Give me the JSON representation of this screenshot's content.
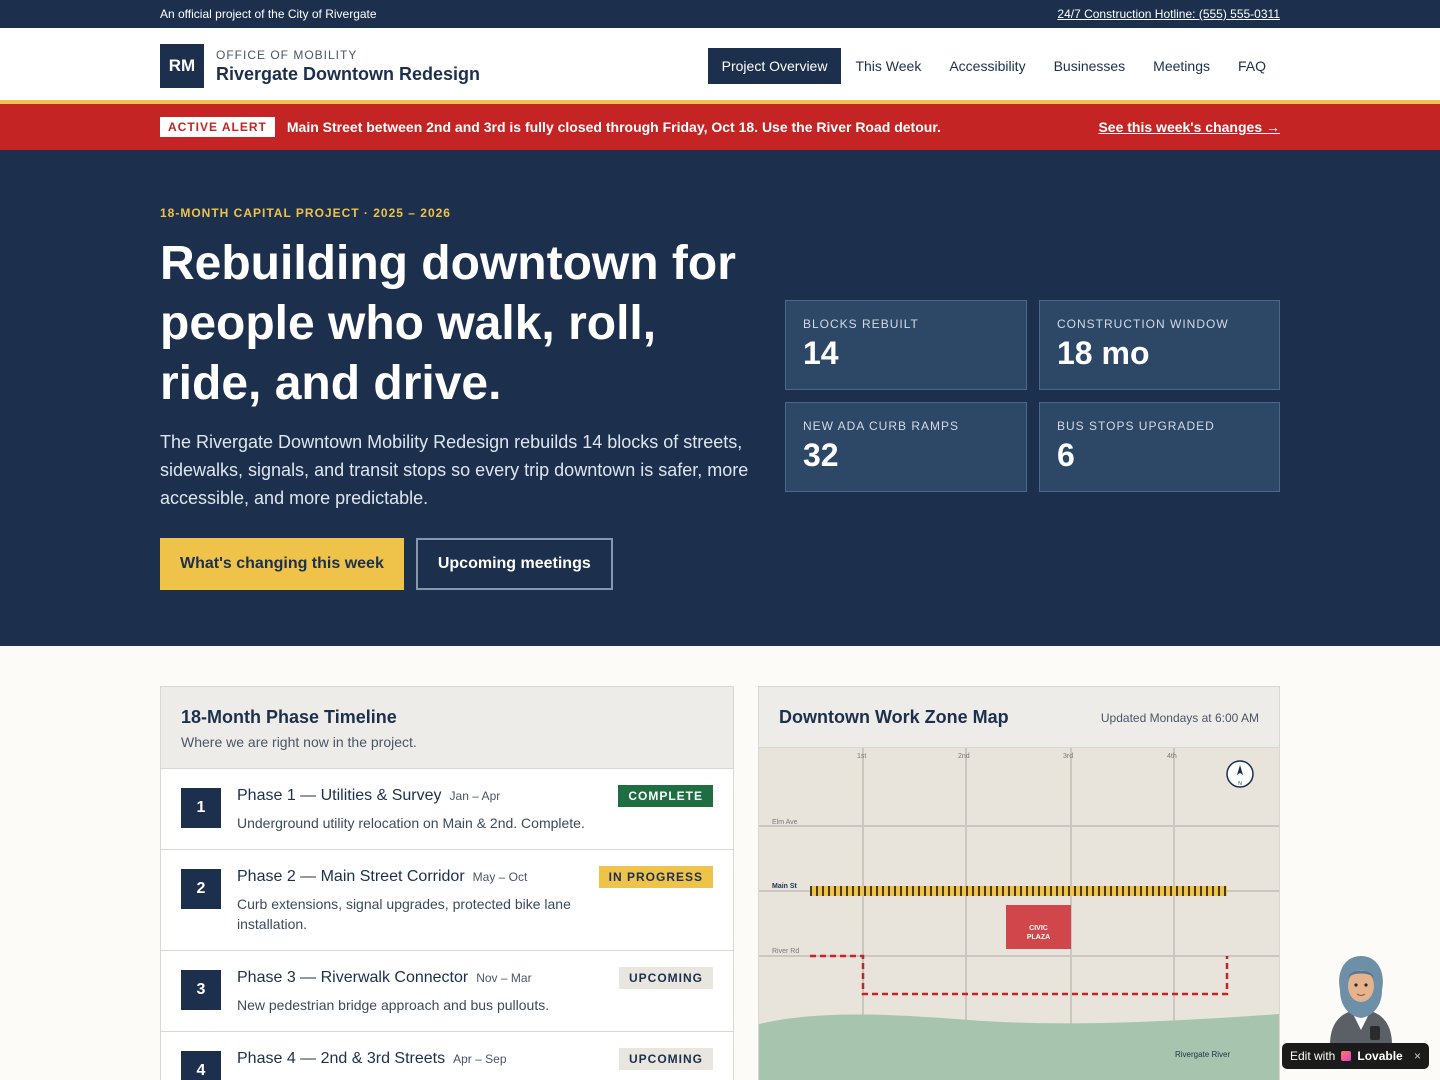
{
  "topbar": {
    "official": "An official project of the City of Rivergate",
    "hotline": "24/7 Construction Hotline: (555) 555-0311"
  },
  "header": {
    "logo": "RM",
    "kicker": "OFFICE OF MOBILITY",
    "name": "Rivergate Downtown Redesign",
    "nav": [
      "Project Overview",
      "This Week",
      "Accessibility",
      "Businesses",
      "Meetings",
      "FAQ"
    ]
  },
  "alert": {
    "badge": "ACTIVE ALERT",
    "text": "Main Street between 2nd and 3rd is fully closed through Friday, Oct 18. Use the River Road detour.",
    "link": "See this week's changes →"
  },
  "hero": {
    "eyebrow": "18-MONTH CAPITAL PROJECT · 2025 – 2026",
    "title": "Rebuilding downtown for people who walk, roll, ride, and drive.",
    "body": "The Rivergate Downtown Mobility Redesign rebuilds 14 blocks of streets, sidewalks, signals, and transit stops so every trip downtown is safer, more accessible, and more predictable.",
    "cta_primary": "What's changing this week",
    "cta_secondary": "Upcoming meetings",
    "stats": [
      {
        "label": "BLOCKS REBUILT",
        "value": "14"
      },
      {
        "label": "CONSTRUCTION WINDOW",
        "value": "18 mo"
      },
      {
        "label": "NEW ADA CURB RAMPS",
        "value": "32"
      },
      {
        "label": "BUS STOPS UPGRADED",
        "value": "6"
      }
    ]
  },
  "timeline": {
    "title": "18-Month Phase Timeline",
    "subtitle": "Where we are right now in the project.",
    "phases": [
      {
        "num": "1",
        "title": "Phase 1 — Utilities & Survey",
        "dates": "Jan – Apr",
        "desc": "Underground utility relocation on Main & 2nd. Complete.",
        "status": "COMPLETE"
      },
      {
        "num": "2",
        "title": "Phase 2 — Main Street Corridor",
        "dates": "May – Oct",
        "desc": "Curb extensions, signal upgrades, protected bike lane installation.",
        "status": "IN PROGRESS"
      },
      {
        "num": "3",
        "title": "Phase 3 — Riverwalk Connector",
        "dates": "Nov – Mar",
        "desc": "New pedestrian bridge approach and bus pullouts.",
        "status": "UPCOMING"
      },
      {
        "num": "4",
        "title": "Phase 4 — 2nd & 3rd Streets",
        "dates": "Apr – Sep",
        "desc": "",
        "status": "UPCOMING"
      }
    ]
  },
  "map": {
    "title": "Downtown Work Zone Map",
    "updated": "Updated Mondays at 6:00 AM",
    "streets": {
      "c1": "1st",
      "c2": "2nd",
      "c3": "3rd",
      "c4": "4th",
      "elm": "Elm Ave",
      "main": "Main St",
      "river_rd": "River Rd"
    },
    "plaza_line1": "CIVIC",
    "plaza_line2": "PLAZA",
    "river": "Rivergate River",
    "compass": "N",
    "colors": {
      "work_zone": "#efc349",
      "detour": "#c42524",
      "plaza": "#d0464a",
      "river": "#a7c4ae"
    }
  },
  "widget": {
    "edit_with": "Edit with",
    "brand": "Lovable",
    "close": "×"
  }
}
